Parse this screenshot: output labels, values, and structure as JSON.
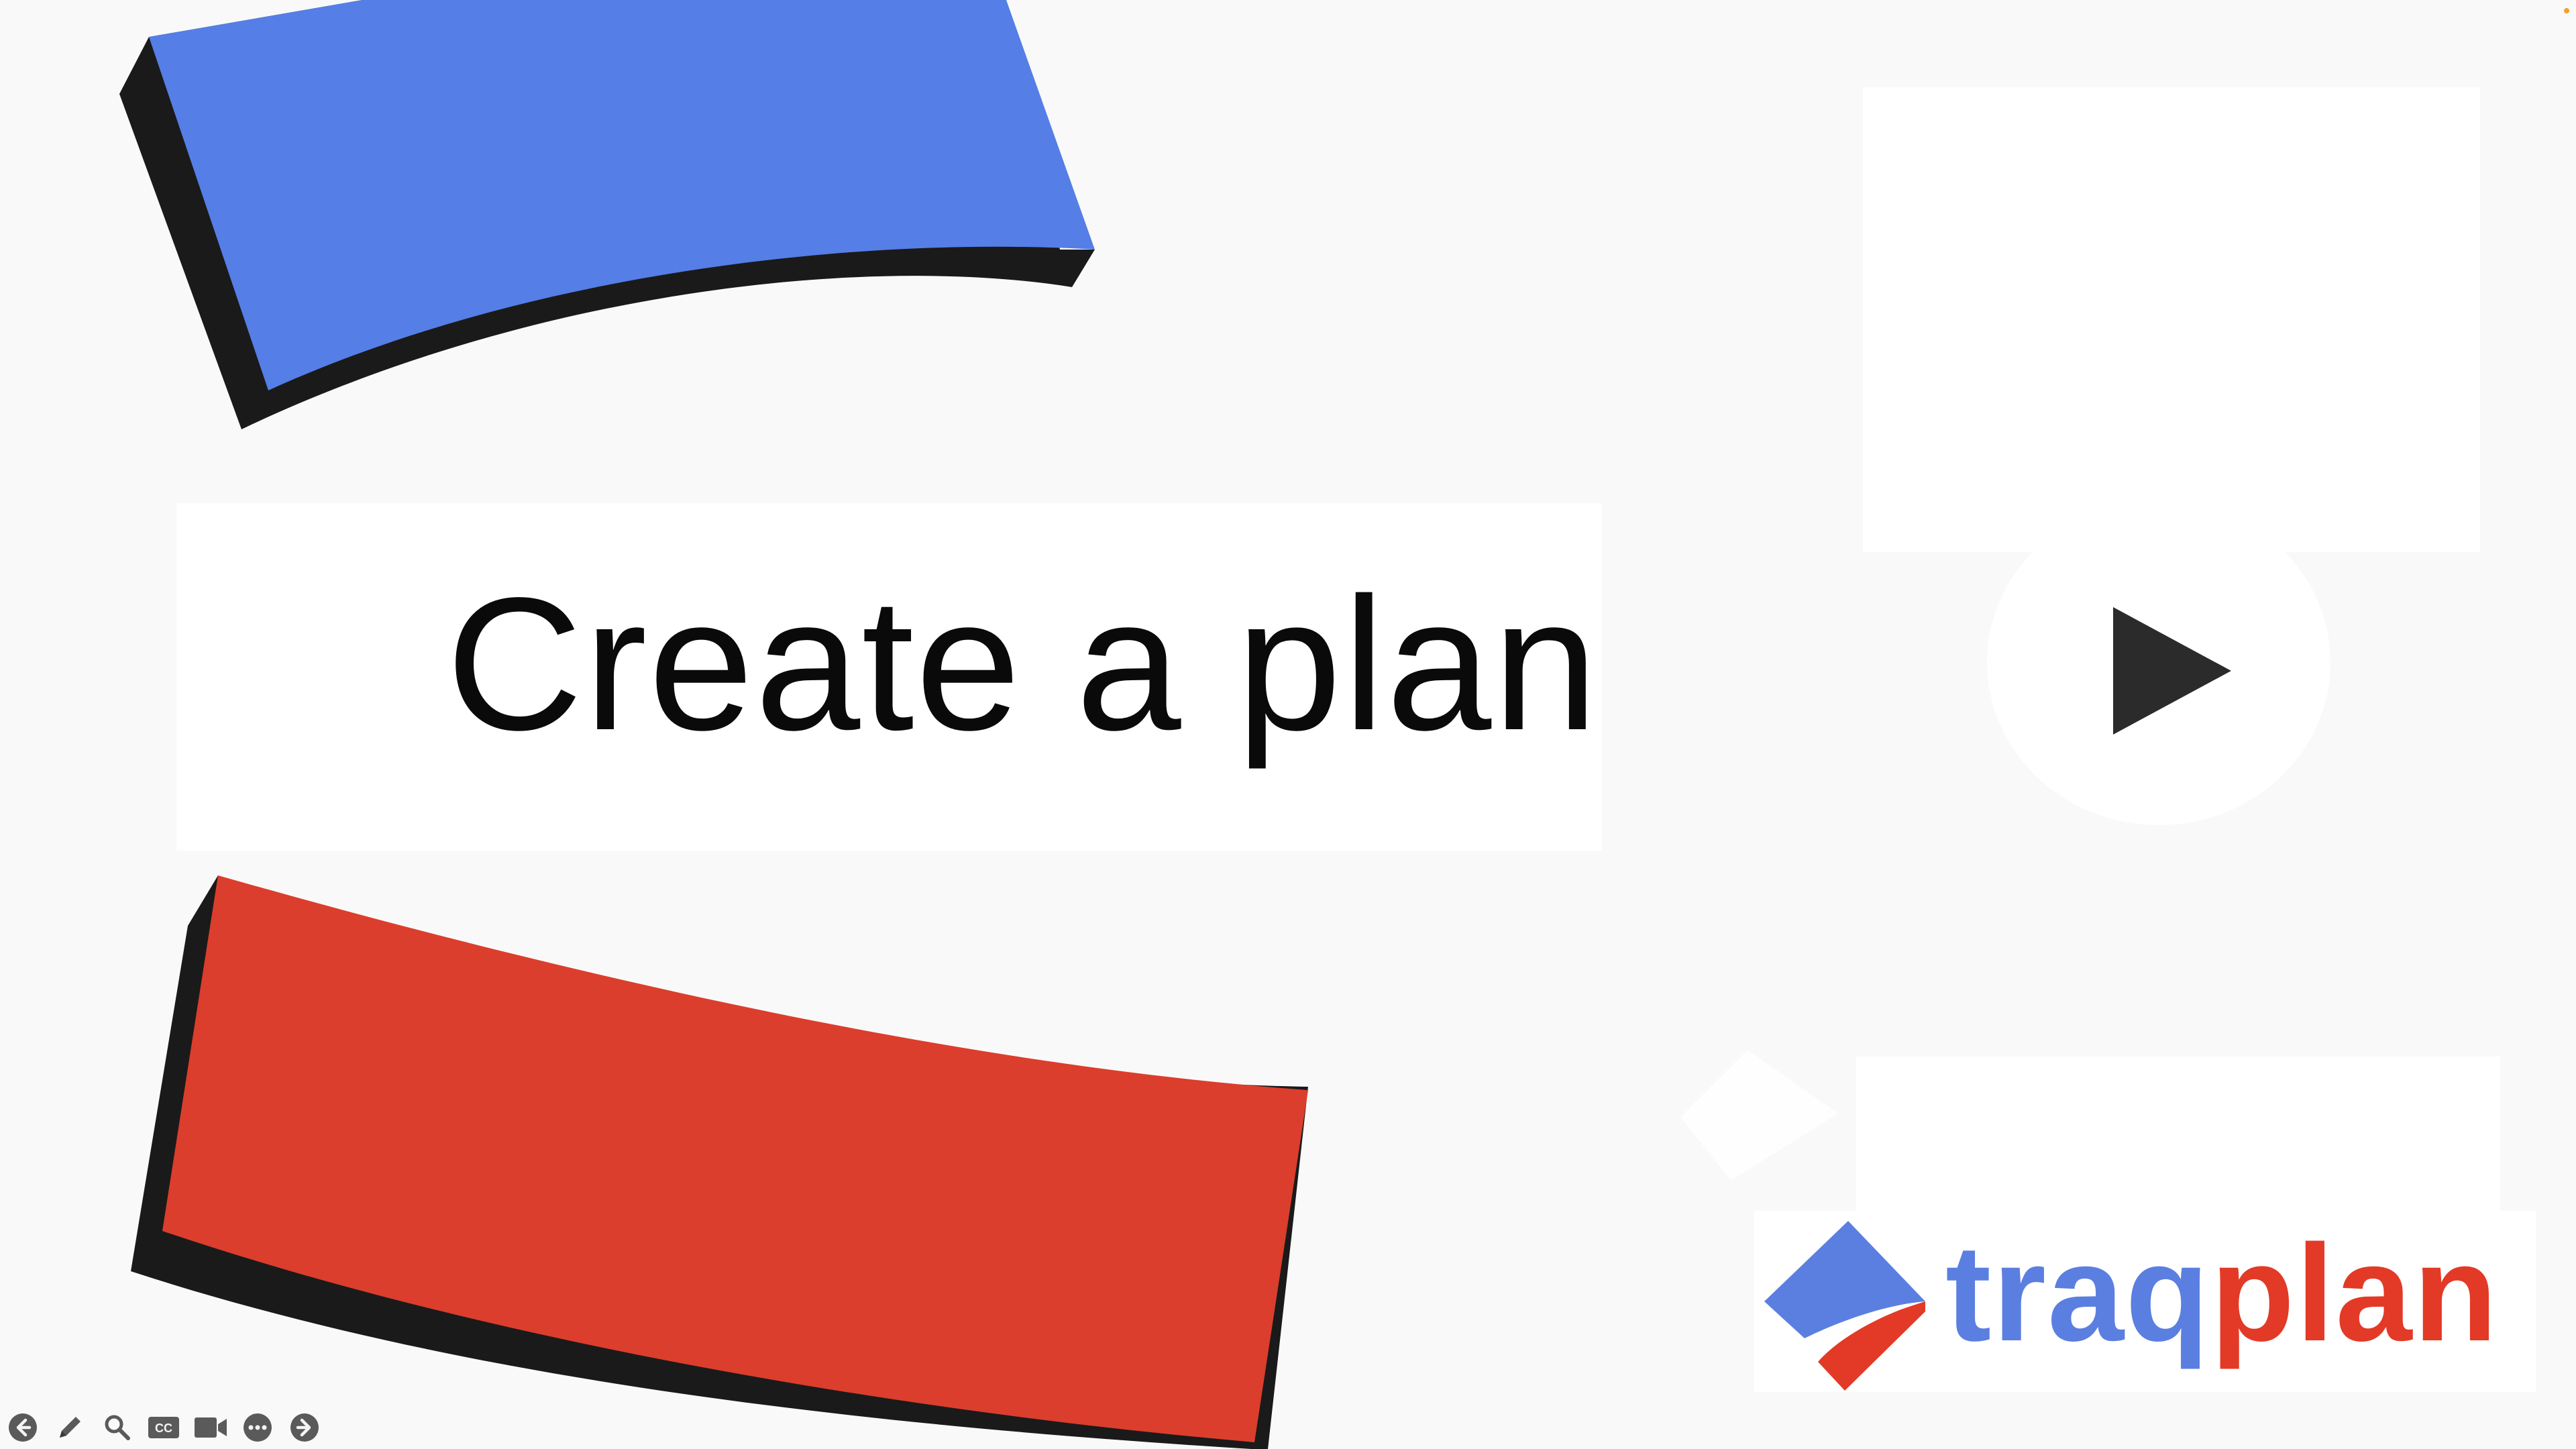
{
  "slide": {
    "title": "Create a plan",
    "background_color": "#f9f9f9"
  },
  "colors": {
    "blue": "#557ee6",
    "red": "#db3e2c",
    "shadow": "#1a1a1a"
  },
  "play_button": {
    "icon": "play-icon"
  },
  "logo": {
    "brand": "traqplan",
    "word_part_blue": "traq",
    "word_part_red": "plan",
    "blue": "#5b7fe0",
    "red": "#e23a26"
  },
  "toolbar": {
    "buttons": [
      {
        "name": "previous-slide-button",
        "icon": "arrow-left-circle-icon"
      },
      {
        "name": "pen-button",
        "icon": "pencil-icon"
      },
      {
        "name": "zoom-button",
        "icon": "magnifier-icon"
      },
      {
        "name": "captions-button",
        "icon": "cc-icon",
        "label": "CC"
      },
      {
        "name": "camera-button",
        "icon": "video-camera-icon"
      },
      {
        "name": "more-options-button",
        "icon": "ellipsis-circle-icon"
      },
      {
        "name": "next-slide-button",
        "icon": "arrow-right-circle-icon"
      }
    ]
  }
}
